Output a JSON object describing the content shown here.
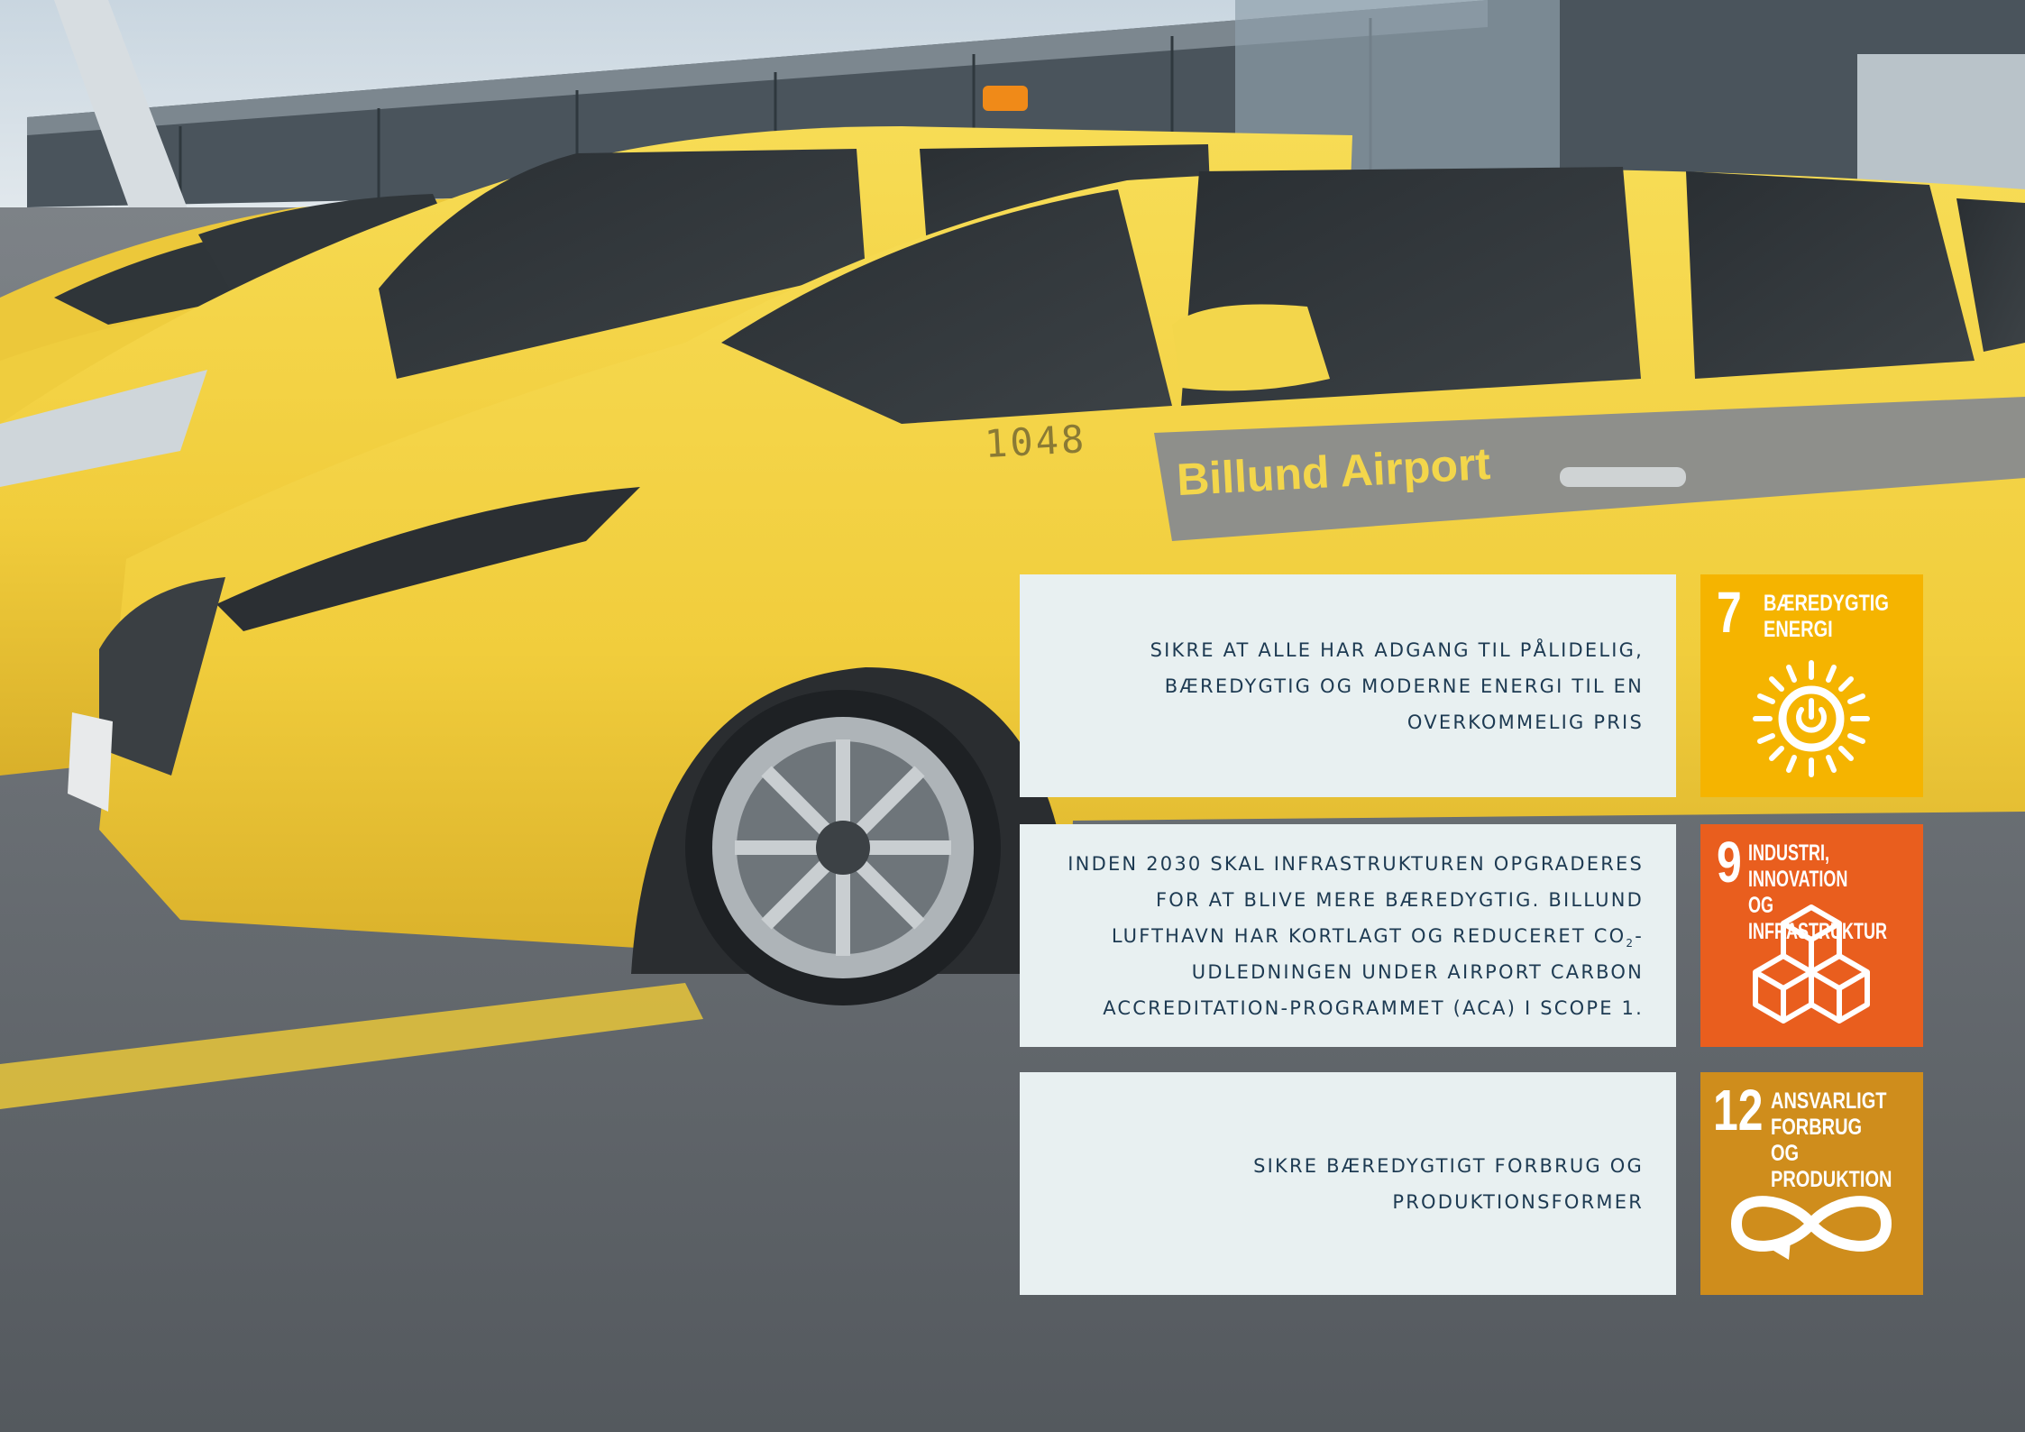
{
  "photo": {
    "description_icon": "photo-yellow-airport-cars",
    "car_number": "1048",
    "door_logo": "Billund Airport"
  },
  "goals": [
    {
      "statement": "SIKRE AT ALLE HAR ADGANG TIL PÅLIDELIG, BÆREDYGTIG OG MODERNE ENERGI TIL EN OVERKOMMELIG PRIS",
      "number": "7",
      "title": "BÆREDYGTIG\nENERGI",
      "color": "#f5b400",
      "icon": "sun-power-icon"
    },
    {
      "statement_parts": [
        "INDEN 2030 SKAL INFRASTRUKTUREN OPGRADERES FOR AT BLIVE MERE BÆREDYGTIG. BILLUND LUFTHAVN HAR KORTLAGT OG REDUCERET CO",
        "2",
        "-UDLEDNINGEN UNDER AIRPORT CARBON ACCREDITATION-PROGRAMMET (ACA) I SCOPE 1."
      ],
      "number": "9",
      "title": "INDUSTRI, INNOVATION\nOG INFRASTRUKTUR",
      "color": "#e95e1e",
      "icon": "cubes-icon"
    },
    {
      "statement": "SIKRE BÆREDYGTIGT FORBRUG OG PRODUKTIONSFORMER",
      "number": "12",
      "title": "ANSVARLIGT\nFORBRUG\nOG PRODUKTION",
      "color": "#cf8d1c",
      "icon": "infinity-loop-icon"
    }
  ]
}
